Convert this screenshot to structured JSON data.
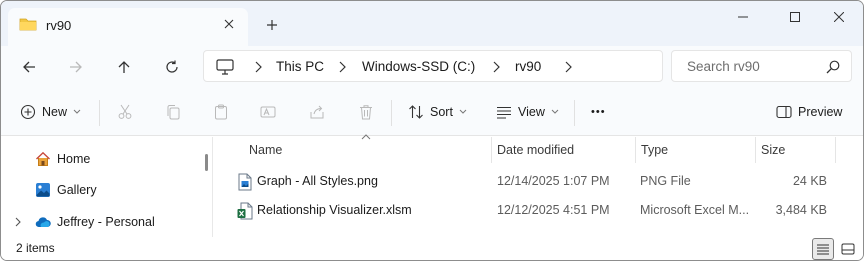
{
  "tab": {
    "title": "rv90",
    "close_glyph": "×",
    "new_tab_glyph": "+"
  },
  "address": {
    "breadcrumbs": [
      "This PC",
      "Windows-SSD (C:)",
      "rv90"
    ],
    "search_placeholder": "Search rv90"
  },
  "commands": {
    "new_label": "New",
    "sort_label": "Sort",
    "view_label": "View",
    "more_label": "•••",
    "preview_label": "Preview"
  },
  "nav": {
    "items": [
      {
        "label": "Home",
        "icon": "home-icon"
      },
      {
        "label": "Gallery",
        "icon": "gallery-icon"
      },
      {
        "label": "Jeffrey - Personal",
        "icon": "onedrive-cloud-icon"
      }
    ]
  },
  "columns": [
    "Name",
    "Date modified",
    "Type",
    "Size"
  ],
  "files": [
    {
      "name": "Graph - All Styles.png",
      "date": "12/14/2025 1:07 PM",
      "type": "PNG File",
      "size": "24 KB",
      "icon": "png-file-icon"
    },
    {
      "name": "Relationship Visualizer.xlsm",
      "date": "12/12/2025 4:51 PM",
      "type": "Microsoft Excel M...",
      "size": "3,484 KB",
      "icon": "excel-file-icon"
    }
  ],
  "status": {
    "item_count": "2 items"
  },
  "colors": {
    "titlebar": "#eef3fa",
    "toolbar": "#f9fbfd",
    "folder": "#f2c744",
    "onedrive": "#0f6cbd",
    "excel": "#1d6f42"
  }
}
